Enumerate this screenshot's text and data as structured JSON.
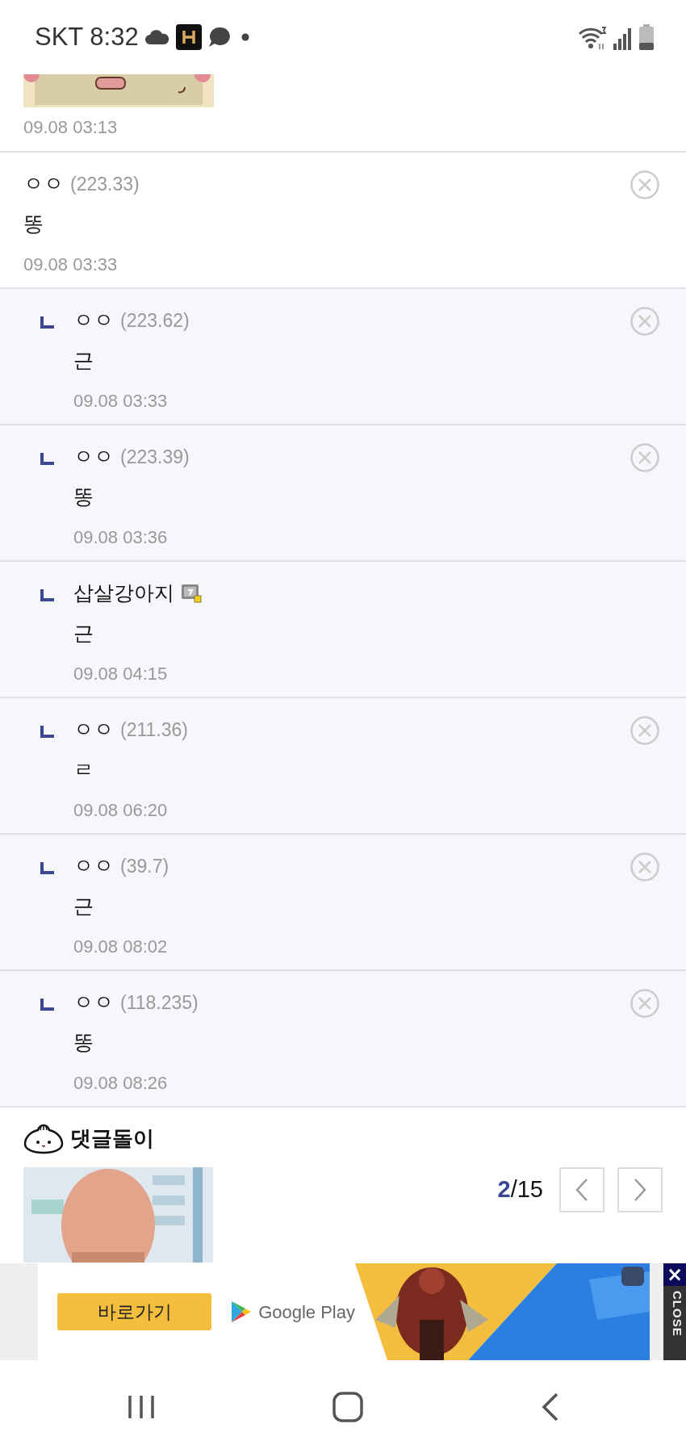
{
  "status_bar": {
    "carrier": "SKT",
    "time": "8:32"
  },
  "top_comment": {
    "time": "09.08 03:13"
  },
  "comments": [
    {
      "kind": "comment",
      "author": "ㅇㅇ",
      "ip": "(223.33)",
      "member": false,
      "deletable": true,
      "text": "똥",
      "time": "09.08 03:33"
    },
    {
      "kind": "reply",
      "author": "ㅇㅇ",
      "ip": "(223.62)",
      "member": false,
      "deletable": true,
      "text": "근",
      "time": "09.08 03:33"
    },
    {
      "kind": "reply",
      "author": "ㅇㅇ",
      "ip": "(223.39)",
      "member": false,
      "deletable": true,
      "text": "똥",
      "time": "09.08 03:36"
    },
    {
      "kind": "reply",
      "author": "삽살강아지",
      "member": true,
      "deletable": false,
      "text": "근",
      "time": "09.08 04:15"
    },
    {
      "kind": "reply",
      "author": "ㅇㅇ",
      "ip": "(211.36)",
      "member": false,
      "deletable": true,
      "text": "ㄹ",
      "time": "09.08 06:20"
    },
    {
      "kind": "reply",
      "author": "ㅇㅇ",
      "ip": "(39.7)",
      "member": false,
      "deletable": true,
      "text": "근",
      "time": "09.08 08:02"
    },
    {
      "kind": "reply",
      "author": "ㅇㅇ",
      "ip": "(118.235)",
      "member": false,
      "deletable": true,
      "text": "똥",
      "time": "09.08 08:26"
    }
  ],
  "bot": {
    "title": "댓글돌이",
    "pager": "**2**/15"
  },
  "ad": {
    "button": "바로가기",
    "store": "Google Play",
    "close_mark": "×",
    "close": "CLOSE"
  }
}
